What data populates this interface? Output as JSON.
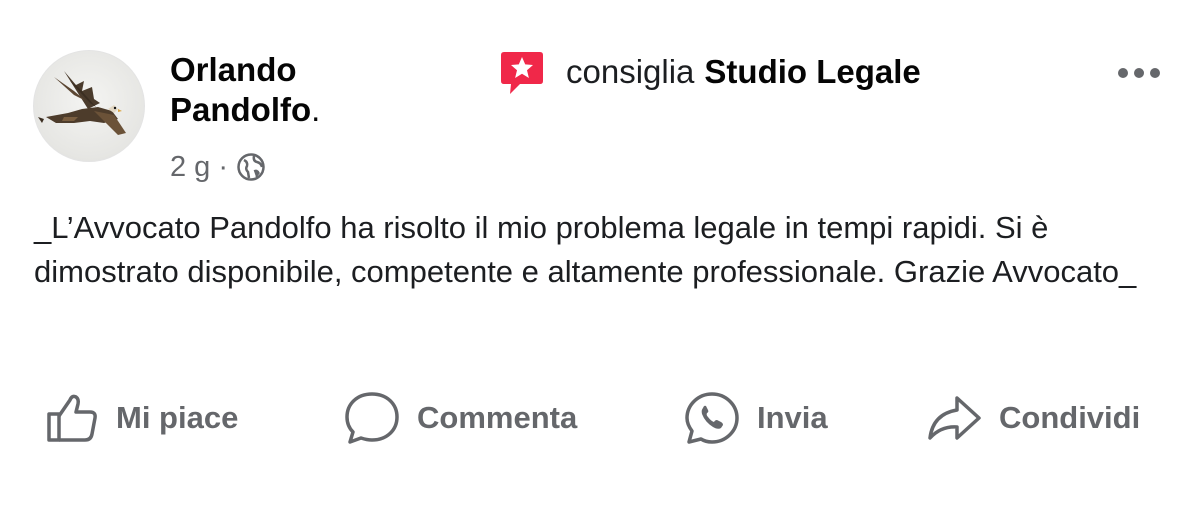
{
  "author": {
    "name_line1": "Orlando",
    "name_line2": "Pandolfo",
    "name_suffix": "."
  },
  "recommendation": {
    "icon": "recommend-star-icon",
    "verb": "consiglia",
    "target": "Studio Legale"
  },
  "meta": {
    "time": "2 g",
    "separator": "·",
    "audience_icon": "globe-icon"
  },
  "post": {
    "text": "_L’Avvocato Pandolfo ha risolto il mio problema legale in tempi rapidi. Si è dimostrato disponibile, competente e altamente professionale. Grazie Avvocato_"
  },
  "actions": {
    "like": "Mi piace",
    "comment": "Commenta",
    "send": "Invia",
    "share": "Condividi"
  },
  "colors": {
    "recommend_accent": "#f02849",
    "secondary_text": "#65676b",
    "primary_text": "#050505"
  }
}
